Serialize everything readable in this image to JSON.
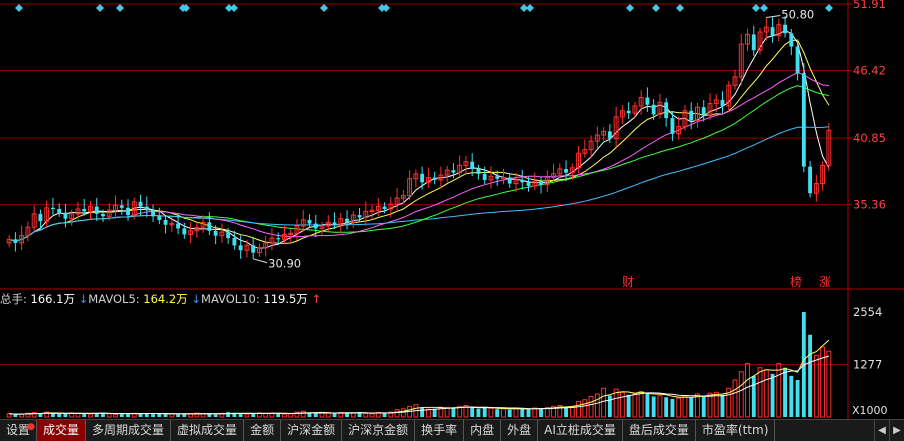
{
  "price_axis": {
    "ticks": [
      "51.91",
      "46.42",
      "40.85",
      "35.36"
    ],
    "tick_values": [
      51.91,
      46.42,
      40.85,
      35.36
    ],
    "color": "#ff4040"
  },
  "price_annotations": {
    "high": "50.80",
    "low": "30.90"
  },
  "event_markers": {
    "cai": "财",
    "bang": "榜",
    "zhang": "涨"
  },
  "volume_axis": {
    "ticks": [
      "2554",
      "1277"
    ],
    "unit": "X1000"
  },
  "volume_legend": {
    "total_label": "总手:",
    "total_value": "166.1万",
    "ma5_label": "MAVOL5:",
    "ma5_value": "164.2万",
    "ma10_label": "MAVOL10:",
    "ma10_value": "119.5万"
  },
  "tabs": {
    "settings": "设置",
    "items": [
      "成交量",
      "多周期成交量",
      "虚拟成交量",
      "金额",
      "沪深金额",
      "沪深京金额",
      "换手率",
      "内盘",
      "外盘",
      "AI立桩成交量",
      "盘后成交量",
      "市盈率(ttm)"
    ],
    "active_index": 0
  },
  "colors": {
    "up": "#ff3030",
    "down": "#40e0f0",
    "ma5": "#ffffff",
    "ma10": "#ffff60",
    "ma20": "#ff60ff",
    "ma30": "#40ff40",
    "ma60": "#40c0ff",
    "grid": "#8b0000",
    "axis_text": "#ff4040"
  },
  "chart_data": {
    "type": "candlestick",
    "price_range": [
      30.9,
      51.91
    ],
    "high_value": 50.8,
    "low_value": 30.9,
    "close_series": [
      32.5,
      32.2,
      32.8,
      33.5,
      34.6,
      34.0,
      35.1,
      35.0,
      34.7,
      34.2,
      34.6,
      35.0,
      34.8,
      35.2,
      34.6,
      34.4,
      34.9,
      35.3,
      35.1,
      34.5,
      35.6,
      35.2,
      34.9,
      34.4,
      34.1,
      33.7,
      33.8,
      33.4,
      32.9,
      33.2,
      33.5,
      33.9,
      33.2,
      32.8,
      33.1,
      32.6,
      32.0,
      31.6,
      32.0,
      31.4,
      31.8,
      32.2,
      32.6,
      32.5,
      32.9,
      33.0,
      33.6,
      34.1,
      33.8,
      33.4,
      33.6,
      33.9,
      33.7,
      34.2,
      33.9,
      34.5,
      34.3,
      34.8,
      34.9,
      35.2,
      35.0,
      35.4,
      35.9,
      36.1,
      37.5,
      37.9,
      37.2,
      37.6,
      37.4,
      37.8,
      38.2,
      38.0,
      38.6,
      38.9,
      38.3,
      37.9,
      37.4,
      37.7,
      37.5,
      37.6,
      37.1,
      37.4,
      37.2,
      36.9,
      37.3,
      37.0,
      37.6,
      37.9,
      38.3,
      38.0,
      38.4,
      39.6,
      39.9,
      40.6,
      41.1,
      41.4,
      40.8,
      42.6,
      43.1,
      42.9,
      43.5,
      44.2,
      43.6,
      42.8,
      43.8,
      42.5,
      41.2,
      41.8,
      43.1,
      42.3,
      43.4,
      42.7,
      43.7,
      44.0,
      43.5,
      45.2,
      45.9,
      48.6,
      49.4,
      48.1,
      49.6,
      50.0,
      49.3,
      50.2,
      49.5,
      48.4,
      46.2,
      38.5,
      36.3,
      37.1,
      38.6,
      41.5
    ],
    "volume_series": [
      80,
      60,
      70,
      90,
      110,
      95,
      120,
      85,
      75,
      80,
      100,
      90,
      85,
      70,
      95,
      110,
      80,
      60,
      75,
      85,
      90,
      95,
      80,
      70,
      85,
      90,
      75,
      60,
      70,
      80,
      95,
      85,
      75,
      60,
      90,
      120,
      100,
      85,
      70,
      80,
      100,
      90,
      95,
      85,
      70,
      80,
      120,
      140,
      110,
      90,
      100,
      95,
      85,
      110,
      90,
      100,
      120,
      90,
      80,
      110,
      100,
      120,
      180,
      200,
      260,
      300,
      220,
      190,
      200,
      240,
      230,
      210,
      260,
      280,
      240,
      200,
      220,
      210,
      190,
      200,
      180,
      210,
      200,
      190,
      220,
      210,
      230,
      260,
      280,
      250,
      260,
      380,
      420,
      500,
      560,
      700,
      520,
      680,
      600,
      540,
      560,
      620,
      580,
      500,
      520,
      480,
      440,
      460,
      520,
      480,
      560,
      520,
      580,
      600,
      540,
      700,
      900,
      1100,
      1300,
      1000,
      1200,
      1150,
      1050,
      1300,
      1200,
      1000,
      900,
      2554,
      2000,
      1500,
      1700,
      1600
    ],
    "ylabel": "",
    "xlabel": ""
  }
}
